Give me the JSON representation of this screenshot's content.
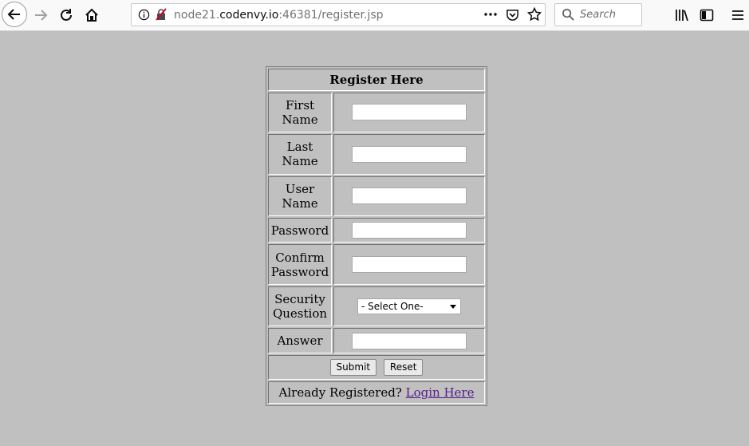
{
  "browser": {
    "url_prefix": "node21.",
    "url_host": "codenvy.io",
    "url_suffix": ":46381/register.jsp",
    "search_placeholder": "Search"
  },
  "form": {
    "title": "Register Here",
    "fields": {
      "first_name": {
        "label_line1": "First",
        "label_line2": "Name",
        "value": ""
      },
      "last_name": {
        "label_line1": "Last",
        "label_line2": "Name",
        "value": ""
      },
      "user_name": {
        "label_line1": "User",
        "label_line2": "Name",
        "value": ""
      },
      "password": {
        "label": "Password",
        "value": ""
      },
      "confirm_password": {
        "label_line1": "Confirm",
        "label_line2": "Password",
        "value": ""
      },
      "security_question": {
        "label_line1": "Security",
        "label_line2": "Question",
        "selected": "- Select One-"
      },
      "answer": {
        "label": "Answer",
        "value": ""
      }
    },
    "submit_label": "Submit",
    "reset_label": "Reset",
    "already_registered_text": "Already Registered?",
    "login_link": "Login Here"
  }
}
